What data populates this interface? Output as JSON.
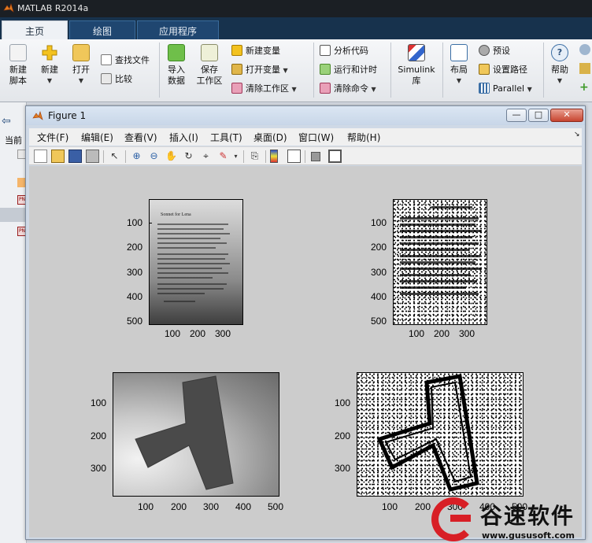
{
  "app": {
    "title": "MATLAB R2014a"
  },
  "tabs": [
    {
      "label": "主页",
      "active": true
    },
    {
      "label": "绘图",
      "active": false
    },
    {
      "label": "应用程序",
      "active": false
    }
  ],
  "ribbon": {
    "new_script": "新建\n脚本",
    "new": "新建",
    "open": "打开",
    "find_files": "查找文件",
    "compare": "比较",
    "import_data": "导入\n数据",
    "save_workspace": "保存\n工作区",
    "new_variable": "新建变量",
    "open_variable": "打开变量",
    "clear_workspace": "清除工作区",
    "analyze_code": "分析代码",
    "run_and_time": "运行和计时",
    "clear_commands": "清除命令",
    "simulink": "Simulink\n库",
    "layout": "布局",
    "preferences": "预设",
    "set_path": "设置路径",
    "parallel": "Parallel",
    "help": "帮助"
  },
  "left_panel": {
    "current_label": "当前"
  },
  "figure": {
    "title": "Figure 1",
    "menu": [
      "文件(F)",
      "编辑(E)",
      "查看(V)",
      "插入(I)",
      "工具(T)",
      "桌面(D)",
      "窗口(W)",
      "帮助(H)"
    ],
    "toolbar_icons": [
      "new-figure-icon",
      "open-file-icon",
      "save-icon",
      "print-icon",
      "pointer-icon",
      "zoom-in-icon",
      "zoom-out-icon",
      "pan-icon",
      "rotate-3d-icon",
      "data-cursor-icon",
      "brush-icon",
      "link-plot-icon",
      "colorbar-icon",
      "legend-icon",
      "hide-plot-tools-icon",
      "show-plot-tools-icon"
    ],
    "doc_title": "Sonnet for Lena",
    "axes": [
      {
        "id": "tl",
        "yticks": [
          "100",
          "200",
          "300",
          "400",
          "500"
        ],
        "xticks": [
          "100",
          "200",
          "300"
        ]
      },
      {
        "id": "tr",
        "yticks": [
          "100",
          "200",
          "300",
          "400",
          "500"
        ],
        "xticks": [
          "100",
          "200",
          "300"
        ]
      },
      {
        "id": "bl",
        "yticks": [
          "100",
          "200",
          "300"
        ],
        "xticks": [
          "100",
          "200",
          "300",
          "400",
          "500"
        ]
      },
      {
        "id": "br",
        "yticks": [
          "100",
          "200",
          "300"
        ],
        "xticks": [
          "100",
          "200",
          "300",
          "400",
          "500"
        ]
      }
    ]
  },
  "watermark": {
    "name": "谷速软件",
    "url": "www.gususoft.com",
    "color": "#d81f26"
  }
}
